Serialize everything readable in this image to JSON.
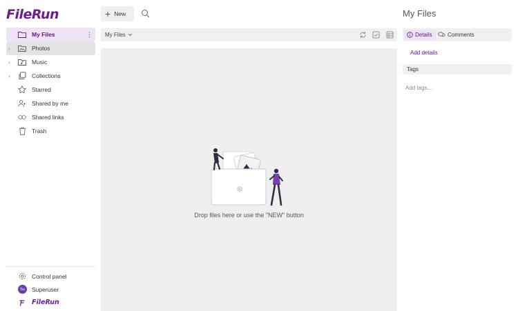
{
  "app": {
    "logo_text": "FileRun",
    "footer_brand": "FileRun"
  },
  "sidebar": {
    "items": [
      {
        "label": "My Files",
        "icon": "folder-icon",
        "state": "active",
        "has_chevron": false
      },
      {
        "label": "Photos",
        "icon": "photo-icon",
        "state": "hover",
        "has_chevron": true
      },
      {
        "label": "Music",
        "icon": "music-icon",
        "state": "",
        "has_chevron": true
      },
      {
        "label": "Collections",
        "icon": "collections-icon",
        "state": "",
        "has_chevron": true
      },
      {
        "label": "Starred",
        "icon": "star-icon",
        "state": "",
        "has_chevron": false
      },
      {
        "label": "Shared by me",
        "icon": "user-share-icon",
        "state": "",
        "has_chevron": false
      },
      {
        "label": "Shared links",
        "icon": "link-icon",
        "state": "",
        "has_chevron": false
      },
      {
        "label": "Trash",
        "icon": "trash-icon",
        "state": "",
        "has_chevron": false
      }
    ],
    "bottom": {
      "control_panel": "Control panel",
      "user": "Superuser",
      "avatar_initials": "Su"
    }
  },
  "toolbar": {
    "new_label": "New"
  },
  "pathbar": {
    "crumb": "My Files"
  },
  "dropzone": {
    "text": "Drop files here or use the \"NEW\" button"
  },
  "right_panel": {
    "title": "My Files",
    "tabs": [
      {
        "label": "Details",
        "icon": "info-icon",
        "active": true
      },
      {
        "label": "Comments",
        "icon": "comments-icon",
        "active": false
      }
    ],
    "add_details": "Add details",
    "tags_heading": "Tags",
    "add_tags_placeholder": "Add tags..."
  },
  "colors": {
    "brand": "#6b1e8f",
    "accent_bg": "#ede3f5",
    "panel_bg": "#efefef"
  }
}
